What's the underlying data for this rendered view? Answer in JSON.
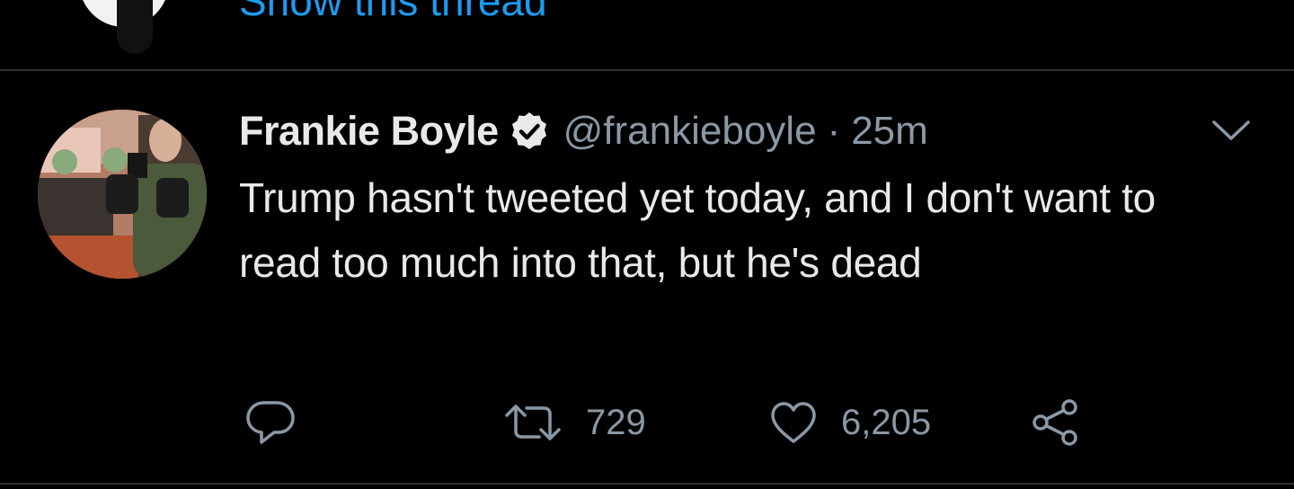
{
  "previous_tweet": {
    "show_thread_label": "Show this thread"
  },
  "tweet": {
    "display_name": "Frankie Boyle",
    "handle": "@frankieboyle",
    "separator": "·",
    "timestamp": "25m",
    "text": "Trump hasn't tweeted yet today, and I don't want to read too much into that, but he's dead",
    "verified": true,
    "actions": {
      "reply_count": "",
      "retweet_count": "729",
      "like_count": "6,205"
    }
  },
  "icons": {
    "reply": "reply-icon",
    "retweet": "retweet-icon",
    "like": "heart-icon",
    "share": "share-icon",
    "more": "chevron-down-icon",
    "verified": "verified-badge-icon"
  },
  "colors": {
    "background": "#000000",
    "link": "#1d9bf0",
    "secondary_text": "#8b98a5",
    "primary_text": "#e7e9ea",
    "divider": "#2f3336"
  }
}
